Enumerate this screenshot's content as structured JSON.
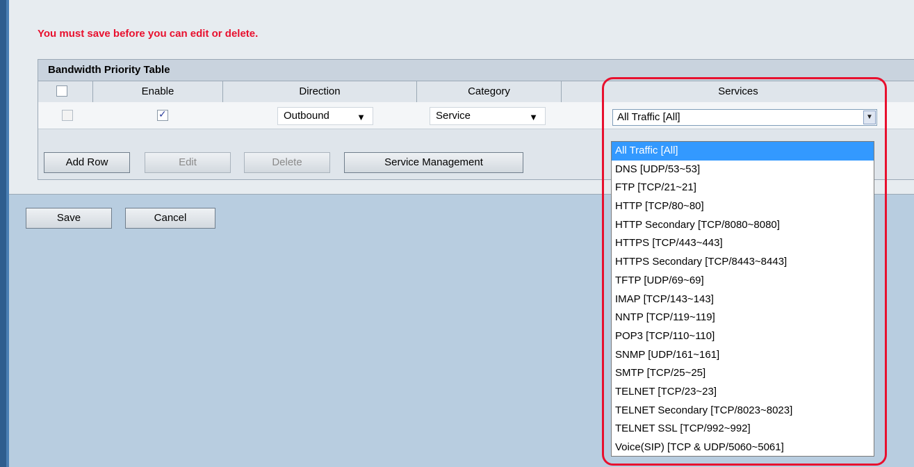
{
  "warning": "You must save before you can edit or delete.",
  "table": {
    "title": "Bandwidth Priority Table",
    "headers": {
      "enable": "Enable",
      "direction": "Direction",
      "category": "Category",
      "services": "Services"
    },
    "row": {
      "enabled": true,
      "direction": "Outbound",
      "category": "Service",
      "service": "All Traffic [All]"
    },
    "buttons": {
      "add_row": "Add Row",
      "edit": "Edit",
      "delete": "Delete",
      "service_management": "Service Management"
    }
  },
  "footer": {
    "save": "Save",
    "cancel": "Cancel"
  },
  "services_options": [
    "All Traffic [All]",
    "DNS [UDP/53~53]",
    "FTP [TCP/21~21]",
    "HTTP [TCP/80~80]",
    "HTTP Secondary [TCP/8080~8080]",
    "HTTPS [TCP/443~443]",
    "HTTPS Secondary [TCP/8443~8443]",
    "TFTP [UDP/69~69]",
    "IMAP [TCP/143~143]",
    "NNTP [TCP/119~119]",
    "POP3 [TCP/110~110]",
    "SNMP [UDP/161~161]",
    "SMTP [TCP/25~25]",
    "TELNET [TCP/23~23]",
    "TELNET Secondary [TCP/8023~8023]",
    "TELNET SSL [TCP/992~992]",
    "Voice(SIP) [TCP & UDP/5060~5061]"
  ],
  "selected_service_index": 0,
  "colors": {
    "warning": "#e8102e",
    "highlight": "#e8102e",
    "selected_option": "#3399ff",
    "background": "#b8cde0"
  }
}
